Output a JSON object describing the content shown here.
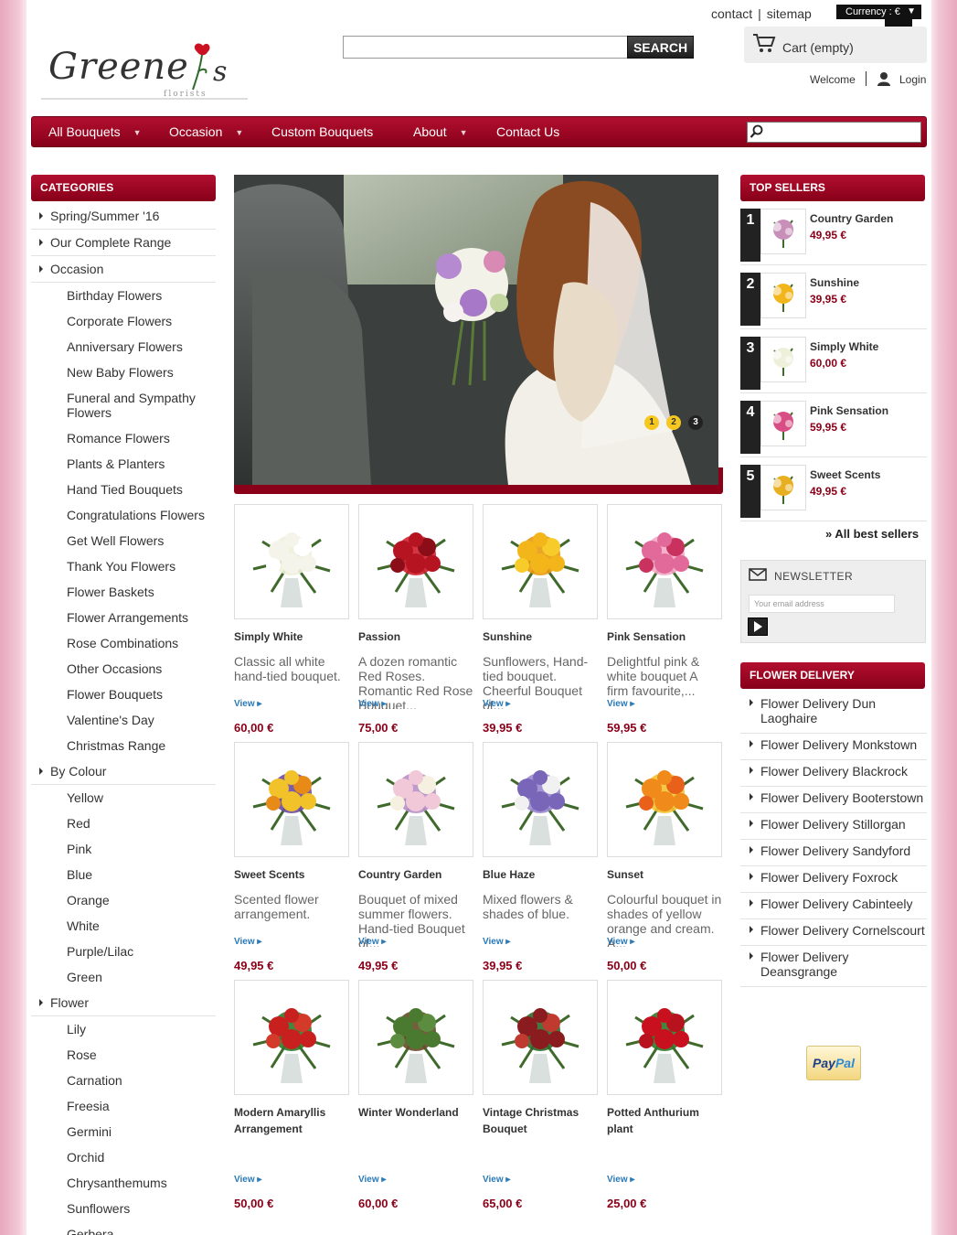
{
  "header": {
    "top_links": [
      "contact",
      "sitemap"
    ],
    "currency_label": "Currency : €",
    "currency_symbol": "€",
    "search_button": "SEARCH",
    "search_value": "",
    "cart_label": "Cart (empty)",
    "welcome": "Welcome",
    "login": "Login",
    "logo_text": "Greene's",
    "logo_sub": "florists"
  },
  "nav": {
    "items": [
      {
        "label": "All Bouquets",
        "dropdown": true
      },
      {
        "label": "Occasion",
        "dropdown": true
      },
      {
        "label": "Custom Bouquets",
        "dropdown": false
      },
      {
        "label": "About",
        "dropdown": true
      },
      {
        "label": "Contact Us",
        "dropdown": false
      }
    ],
    "search_value": ""
  },
  "categories": {
    "title": "CATEGORIES",
    "items": [
      {
        "label": "Spring/Summer '16",
        "level": "top"
      },
      {
        "label": "Our Complete Range",
        "level": "top"
      },
      {
        "label": "Occasion",
        "level": "top"
      },
      {
        "label": "Birthday Flowers",
        "level": "sub"
      },
      {
        "label": "Corporate Flowers",
        "level": "sub"
      },
      {
        "label": "Anniversary Flowers",
        "level": "sub"
      },
      {
        "label": "New Baby Flowers",
        "level": "sub"
      },
      {
        "label": "Funeral and Sympathy Flowers",
        "level": "sub"
      },
      {
        "label": "Romance Flowers",
        "level": "sub"
      },
      {
        "label": "Plants & Planters",
        "level": "sub"
      },
      {
        "label": "Hand Tied Bouquets",
        "level": "sub"
      },
      {
        "label": "Congratulations Flowers",
        "level": "sub"
      },
      {
        "label": "Get Well Flowers",
        "level": "sub"
      },
      {
        "label": "Thank You Flowers",
        "level": "sub"
      },
      {
        "label": "Flower Baskets",
        "level": "sub"
      },
      {
        "label": "Flower Arrangements",
        "level": "sub"
      },
      {
        "label": "Rose Combinations",
        "level": "sub"
      },
      {
        "label": "Other Occasions",
        "level": "sub"
      },
      {
        "label": "Flower Bouquets",
        "level": "sub"
      },
      {
        "label": "Valentine's Day",
        "level": "sub"
      },
      {
        "label": "Christmas Range",
        "level": "sub"
      },
      {
        "label": "By Colour",
        "level": "top"
      },
      {
        "label": "Yellow",
        "level": "sub"
      },
      {
        "label": "Red",
        "level": "sub"
      },
      {
        "label": "Pink",
        "level": "sub"
      },
      {
        "label": "Blue",
        "level": "sub"
      },
      {
        "label": "Orange",
        "level": "sub"
      },
      {
        "label": "White",
        "level": "sub"
      },
      {
        "label": "Purple/Lilac",
        "level": "sub"
      },
      {
        "label": "Green",
        "level": "sub"
      },
      {
        "label": "Flower",
        "level": "top"
      },
      {
        "label": "Lily",
        "level": "sub"
      },
      {
        "label": "Rose",
        "level": "sub"
      },
      {
        "label": "Carnation",
        "level": "sub"
      },
      {
        "label": "Freesia",
        "level": "sub"
      },
      {
        "label": "Germini",
        "level": "sub"
      },
      {
        "label": "Orchid",
        "level": "sub"
      },
      {
        "label": "Chrysanthemums",
        "level": "sub"
      },
      {
        "label": "Sunflowers",
        "level": "sub"
      },
      {
        "label": "Gerbera",
        "level": "sub"
      }
    ]
  },
  "slider": {
    "dots": [
      "1",
      "2",
      "3"
    ],
    "active_dot": 3
  },
  "products": [
    {
      "name": "Simply White",
      "desc": "Classic all white hand-tied bouquet.",
      "view": "View",
      "price": "60,00 €",
      "flowers": [
        "#f4f4ea",
        "#eef0dc",
        "#ffffff"
      ]
    },
    {
      "name": "Passion",
      "desc": " A dozen romantic Red Roses. Romantic Red Rose Bouquet...",
      "view": "View",
      "price": "75,00 €",
      "flowers": [
        "#b51420",
        "#d02030",
        "#8b0d18"
      ]
    },
    {
      "name": "Sunshine",
      "desc": "Sunflowers, Hand-tied bouquet. Cheerful Bouquet of...",
      "view": "View",
      "price": "39,95 €",
      "flowers": [
        "#f2b51a",
        "#e89a10",
        "#f7cb2a"
      ]
    },
    {
      "name": "Pink Sensation",
      "desc": "Delightful pink & white bouquet A firm favourite,...",
      "view": "View",
      "price": "59,95 €",
      "flowers": [
        "#e26a9a",
        "#f3a9c4",
        "#c9315f"
      ]
    },
    {
      "name": "Sweet Scents",
      "desc": "Scented flower arrangement.",
      "view": "View",
      "price": "49,95 €",
      "flowers": [
        "#f1c22a",
        "#6d4ba0",
        "#e88a18"
      ]
    },
    {
      "name": "Country Garden",
      "desc": "Bouquet of mixed summer flowers. Hand-tied Bouquet of...",
      "view": "View",
      "price": "49,95 €",
      "flowers": [
        "#f0c8d8",
        "#b890c8",
        "#f6f0e0"
      ]
    },
    {
      "name": "Blue Haze",
      "desc": "Mixed flowers & shades of blue.",
      "view": "View",
      "price": "39,95 €",
      "flowers": [
        "#7a66b8",
        "#9b8ad0",
        "#f1f1f1"
      ]
    },
    {
      "name": "Sunset",
      "desc": "Colourful bouquet in shades of yellow orange and cream. A...",
      "view": "View",
      "price": "50,00 €",
      "flowers": [
        "#f08a1a",
        "#f2c330",
        "#e8601a"
      ]
    },
    {
      "name": "Modern Amaryllis Arrangement",
      "desc": "",
      "view": "View",
      "price": "50,00 €",
      "flowers": [
        "#c8201e",
        "#2f7a2a",
        "#d43a2a"
      ]
    },
    {
      "name": "Winter Wonderland",
      "desc": "",
      "view": "View",
      "price": "60,00 €",
      "flowers": [
        "#4a7a30",
        "#6a4a2a",
        "#5c8c40"
      ]
    },
    {
      "name": "Vintage Christmas Bouquet",
      "desc": "",
      "view": "View",
      "price": "65,00 €",
      "flowers": [
        "#8a1c20",
        "#2f6a2a",
        "#c03a30"
      ]
    },
    {
      "name": "Potted Anthurium plant",
      "desc": "",
      "view": "View",
      "price": "25,00 €",
      "flowers": [
        "#c8101e",
        "#2f7a2a",
        "#b8121e"
      ]
    }
  ],
  "top_sellers": {
    "title": "TOP SELLERS",
    "items": [
      {
        "num": "1",
        "name": "Country Garden",
        "price": "49,95 €",
        "color": "#c890b8"
      },
      {
        "num": "2",
        "name": "Sunshine",
        "price": "39,95 €",
        "color": "#f2b51a"
      },
      {
        "num": "3",
        "name": "Simply White",
        "price": "60,00 €",
        "color": "#eef0dc"
      },
      {
        "num": "4",
        "name": "Pink Sensation",
        "price": "59,95 €",
        "color": "#d84e84"
      },
      {
        "num": "5",
        "name": "Sweet Scents",
        "price": "49,95 €",
        "color": "#e8b020"
      }
    ],
    "all_link": "» All best sellers"
  },
  "newsletter": {
    "title": "NEWSLETTER",
    "placeholder": "Your email address"
  },
  "flower_delivery": {
    "title": "FLOWER DELIVERY",
    "items": [
      "Flower Delivery Dun Laoghaire",
      "Flower Delivery Monkstown",
      "Flower Delivery Blackrock",
      "Flower Delivery Booterstown",
      "Flower Delivery Stillorgan",
      "Flower Delivery Sandyford",
      "Flower Delivery Foxrock",
      "Flower Delivery Cabinteely",
      "Flower Delivery Cornelscourt",
      "Flower Delivery Deansgrange"
    ]
  },
  "paypal": {
    "part1": "Pay",
    "part2": "Pal"
  },
  "colors": {
    "accent": "#9a0a24",
    "price": "#8a0018",
    "link": "#2a7ab8"
  }
}
